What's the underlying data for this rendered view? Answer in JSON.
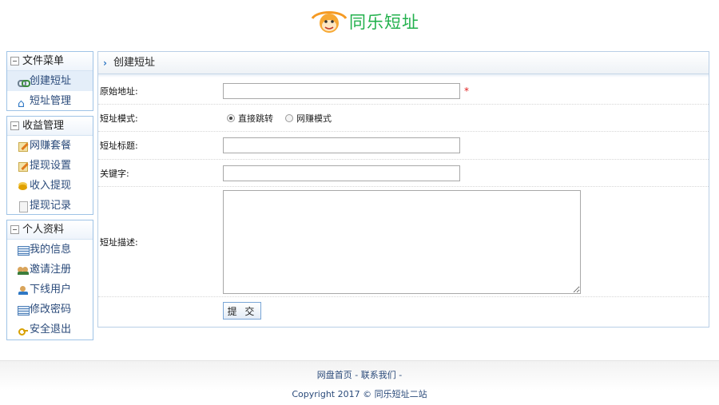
{
  "brand": {
    "name": "同乐短址"
  },
  "sidebar": {
    "groups": [
      {
        "title": "文件菜单",
        "items": [
          {
            "label": "创建短址",
            "icon": "link-icon"
          },
          {
            "label": "短址管理",
            "icon": "home-icon"
          }
        ]
      },
      {
        "title": "收益管理",
        "items": [
          {
            "label": "网赚套餐",
            "icon": "pencil-icon"
          },
          {
            "label": "提现设置",
            "icon": "pencil-icon"
          },
          {
            "label": "收入提现",
            "icon": "coins-icon"
          },
          {
            "label": "提现记录",
            "icon": "document-icon"
          }
        ]
      },
      {
        "title": "个人资料",
        "items": [
          {
            "label": "我的信息",
            "icon": "table-icon"
          },
          {
            "label": "邀请注册",
            "icon": "users-icon"
          },
          {
            "label": "下线用户",
            "icon": "user-icon"
          },
          {
            "label": "修改密码",
            "icon": "table-icon"
          },
          {
            "label": "安全退出",
            "icon": "key-icon"
          }
        ]
      }
    ]
  },
  "main": {
    "title": "创建短址",
    "form": {
      "url_label": "原始地址:",
      "url_value": "",
      "required_mark": "*",
      "mode_label": "短址模式:",
      "mode_options": [
        "直接跳转",
        "网赚模式"
      ],
      "mode_selected": "直接跳转",
      "title_label": "短址标题:",
      "title_value": "",
      "keywords_label": "关键字:",
      "keywords_value": "",
      "desc_label": "短址描述:",
      "desc_value": "",
      "submit_label": "提 交"
    }
  },
  "footer": {
    "link_home": "网盘首页",
    "sep1": " - ",
    "link_contact": "联系我们",
    "sep2": " -",
    "copyright": "Copyright 2017 © 同乐短址二站"
  },
  "colors": {
    "brand_green": "#22b14c",
    "border_blue": "#9fc3e6",
    "link_blue": "#2a4a7a",
    "required_red": "#e02020"
  }
}
